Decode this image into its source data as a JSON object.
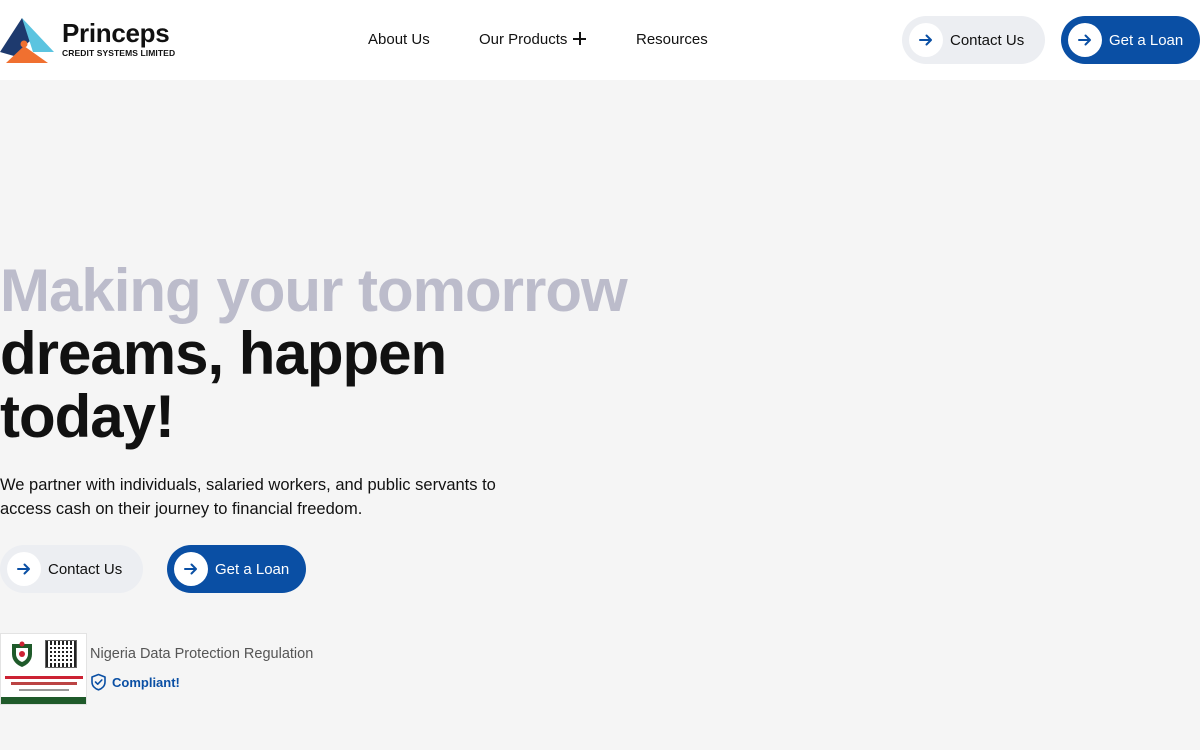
{
  "brand": {
    "name": "Princeps",
    "subtitle": "CREDIT SYSTEMS LIMITED",
    "colors": {
      "primary": "#0a4fa4",
      "light_pill": "#eceef2",
      "muted_heading": "#bcbccb",
      "logo_navy": "#1e3a6e",
      "logo_cyan": "#5bc4e0",
      "logo_orange": "#f07030"
    }
  },
  "nav": {
    "about": "About Us",
    "products": "Our Products",
    "resources": "Resources"
  },
  "header_actions": {
    "contact": "Contact Us",
    "loan": "Get a Loan"
  },
  "hero": {
    "line1": "Making your tomorrow",
    "line2": "dreams, happen",
    "line3": "today!",
    "description": "We partner with individuals, salaried workers, and public servants to access cash on their journey to financial freedom.",
    "contact": "Contact Us",
    "loan": "Get a Loan"
  },
  "badge": {
    "title": "Nigeria Data Protection Regulation",
    "status": "Compliant!"
  },
  "icons": [
    "arrow-right-icon",
    "plus-icon",
    "shield-check-icon",
    "logo-mark"
  ]
}
